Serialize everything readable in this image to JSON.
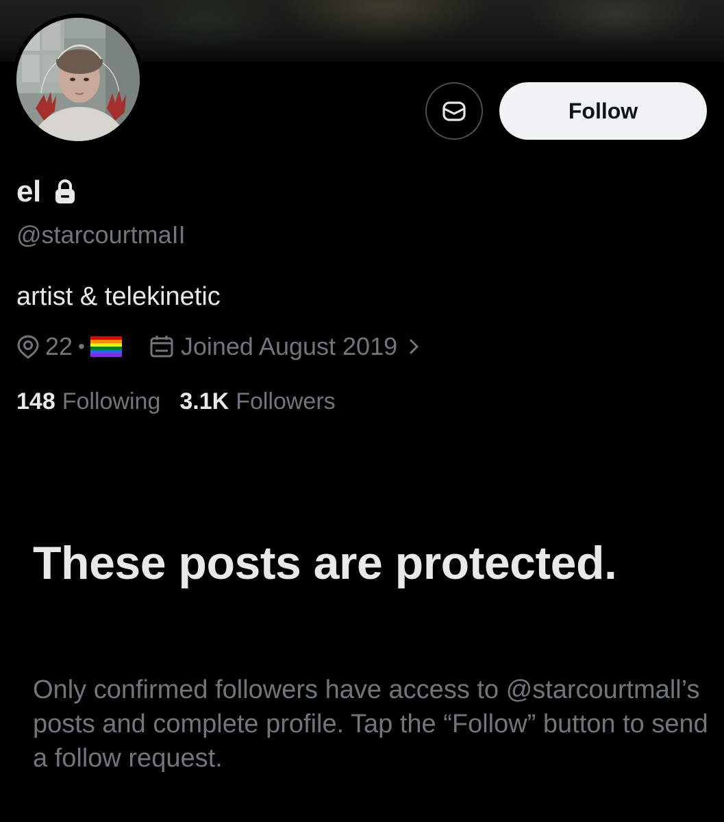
{
  "profile": {
    "display_name": "el",
    "handle": "@starcourtmaII",
    "bio": "artist & telekinetic",
    "location": "22",
    "location_separator": "•",
    "joined": "Joined August 2019",
    "following_count": "148",
    "following_label": "Following",
    "followers_count": "3.1K",
    "followers_label": "Followers"
  },
  "actions": {
    "follow_label": "Follow",
    "message_icon": "envelope-icon"
  },
  "protected": {
    "title": "These posts are protected.",
    "message": "Only confirmed followers have access to @starcourtmall’s posts and complete profile. Tap the “Follow” button to send a follow request."
  },
  "colors": {
    "background": "#000000",
    "primary_text": "#e7e9ea",
    "secondary_text": "#71767b",
    "follow_button_bg": "#eff3f4",
    "follow_button_text": "#0f1419"
  }
}
